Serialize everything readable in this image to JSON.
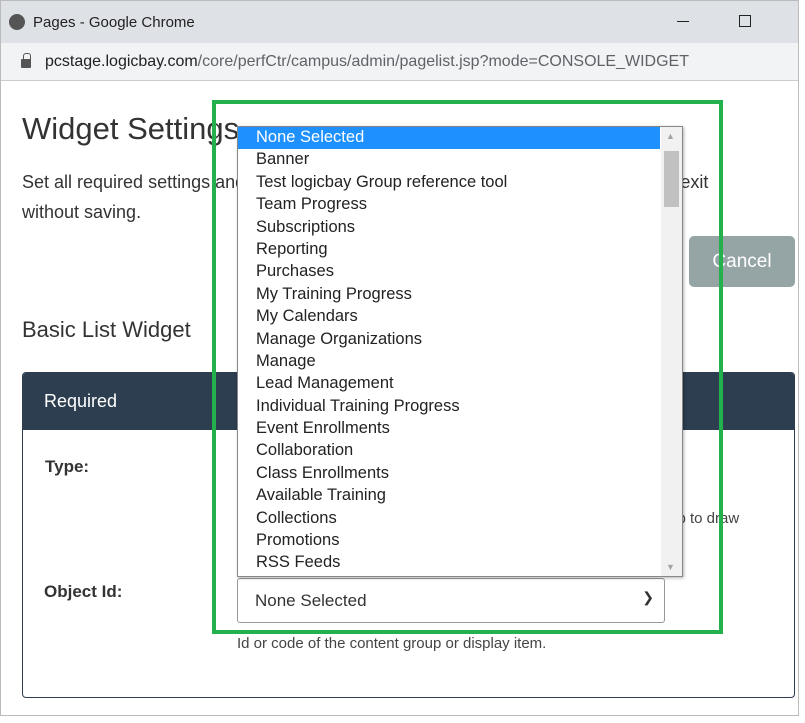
{
  "window": {
    "title": "Pages - Google Chrome",
    "url_host": "pcstage.logicbay.com",
    "url_path": "/core/perfCtr/campus/admin/pagelist.jsp?mode=CONSOLE_WIDGET"
  },
  "page": {
    "title": "Widget Settings",
    "description": "Set all required settings and any optional settings, then click Save. Click Cancel to exit without saving.",
    "cancel_label": "Cancel",
    "subtitle": "Basic List Widget",
    "panel_title": "Required",
    "type_label": "Type:",
    "type_help_partial": "mp to draw",
    "object_id_label": "Object Id:",
    "object_id_value": "None Selected",
    "object_id_help": "Id or code of the content group or display item."
  },
  "dropdown": {
    "selected": "None Selected",
    "options": [
      "None Selected",
      "Banner",
      "Test logicbay Group reference tool",
      "Team Progress",
      "Subscriptions",
      "Reporting",
      "Purchases",
      "My Training Progress",
      "My Calendars",
      "Manage Organizations",
      "Manage",
      "Lead Management",
      "Individual Training Progress",
      "Event Enrollments",
      "Collaboration",
      "Class Enrollments",
      "Available Training",
      "Collections",
      "Promotions",
      "RSS Feeds"
    ]
  },
  "colors": {
    "highlight": "#1e90ff",
    "panel_header": "#2c3e50",
    "annotation": "#22b14c"
  }
}
